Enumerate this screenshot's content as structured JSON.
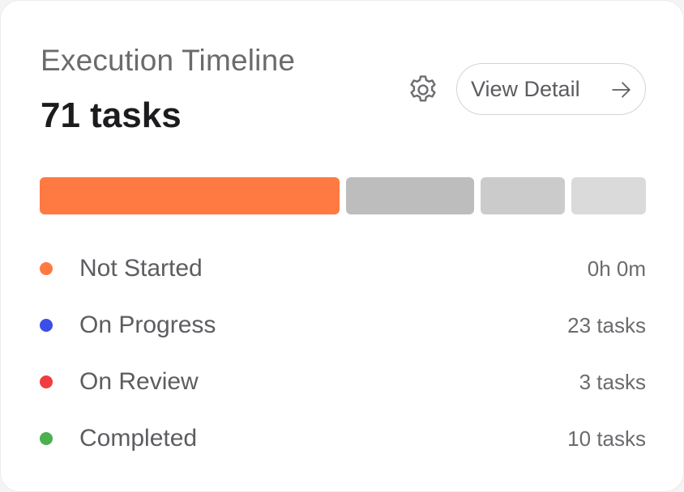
{
  "card": {
    "title": "Execution Timeline",
    "total": "71 tasks",
    "settings_icon": "gear-icon",
    "detail_button_label": "View Detail",
    "detail_button_icon": "arrow-right-icon"
  },
  "progress_bar": {
    "segments": [
      {
        "name": "Not Started",
        "share": 0.5,
        "color": "#ff7a42"
      },
      {
        "name": "On Progress",
        "share": 0.214,
        "color": "#bdbdbd"
      },
      {
        "name": "On Review",
        "share": 0.14,
        "color": "#cbcbcb"
      },
      {
        "name": "Completed",
        "share": 0.124,
        "color": "#dadada"
      }
    ]
  },
  "legend": [
    {
      "label": "Not Started",
      "value": "0h 0m",
      "dot_color": "#ff7a42"
    },
    {
      "label": "On Progress",
      "value": "23 tasks",
      "dot_color": "#3a4fe8"
    },
    {
      "label": "On Review",
      "value": "3 tasks",
      "dot_color": "#f03e3e"
    },
    {
      "label": "Completed",
      "value": "10 tasks",
      "dot_color": "#4caf50"
    }
  ]
}
